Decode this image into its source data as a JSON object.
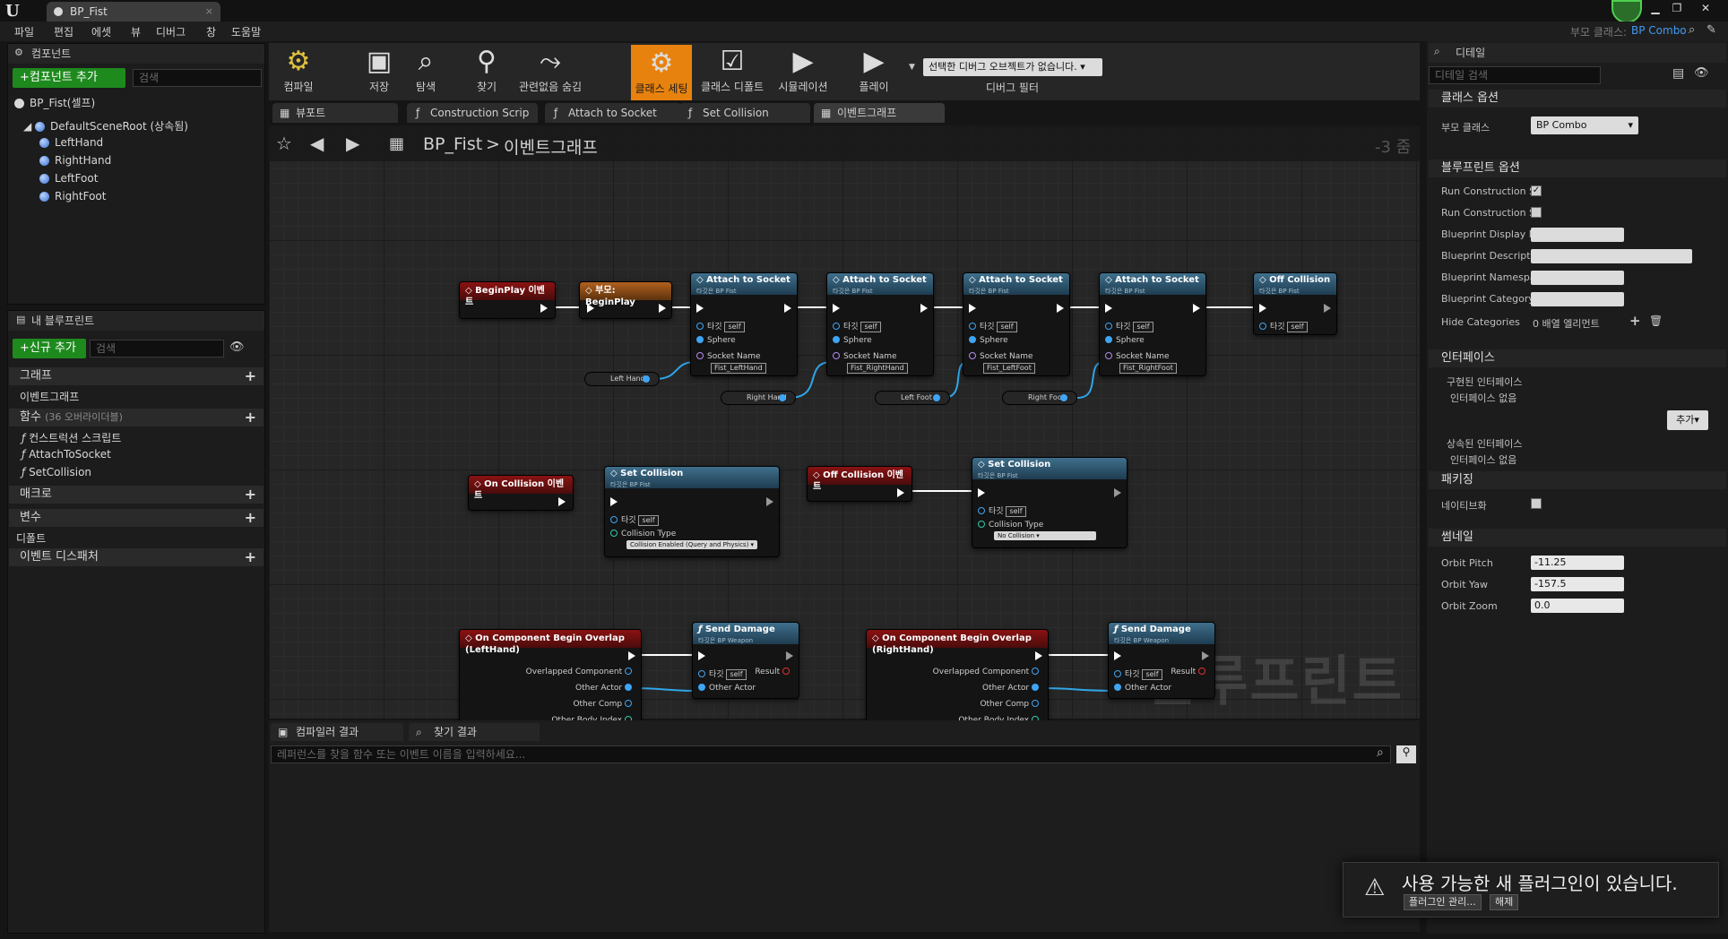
{
  "window": {
    "tab_title": "BP_Fist",
    "tab_close": "×"
  },
  "menu": [
    "파일",
    "편집",
    "에셋",
    "뷰",
    "디버그",
    "창",
    "도움말"
  ],
  "header_right": {
    "parent_class_label": "부모 클래스:",
    "parent_class_value": "BP Combo"
  },
  "components_panel": {
    "title": "컴포넌트",
    "add_button": "+컴포넌트 추가",
    "search_placeholder": "검색",
    "root_item": "BP_Fist(셀프)",
    "scene_root": "DefaultSceneRoot (상속됨)",
    "children": [
      "LeftHand",
      "RightHand",
      "LeftFoot",
      "RightFoot"
    ]
  },
  "my_blueprint": {
    "title": "내 블루프린트",
    "add_button": "+신규 추가",
    "search_placeholder": "검색",
    "sections": {
      "graphs": "그래프",
      "event_graph": "이벤트그래프",
      "functions": "함수",
      "functions_count": "(36 오버라이더블)",
      "function_items": [
        "컨스트럭션 스크립트",
        "AttachToSocket",
        "SetCollision"
      ],
      "macros": "매크로",
      "variables": "변수",
      "default": "디폴트",
      "dispatchers": "이벤트 디스패처"
    }
  },
  "toolbar": {
    "compile": "컴파일",
    "save": "저장",
    "browse": "탐색",
    "find": "찾기",
    "hide_unrelated": "관련없음 숨김",
    "class_settings": "클래스 세팅",
    "class_defaults": "클래스 디폴트",
    "simulation": "시뮬레이션",
    "play": "플레이",
    "debug_object": "선택한 디버그 오브젝트가 없습니다.",
    "debug_filter": "디버그 필터"
  },
  "graph_tabs": [
    "뷰포트",
    "Construction Scrip",
    "Attach to Socket",
    "Set Collision",
    "이벤트그래프"
  ],
  "graph": {
    "breadcrumb_root": "BP_Fist",
    "breadcrumb_sep": ">",
    "breadcrumb_current": "이벤트그래프",
    "zoom": "-3 줌",
    "watermark": "블루프린트"
  },
  "nodes": {
    "beginplay": "BeginPlay 이벤트",
    "parent_beginplay": "부모: BeginPlay",
    "attach_title": "Attach to Socket",
    "bp_fist_target": "타깃은 BP Fist",
    "target": "타깃",
    "self": "self",
    "sphere": "Sphere",
    "socket_name": "Socket Name",
    "sockets": [
      "Fist_LeftHand",
      "Fist_RightHand",
      "Fist_LeftFoot",
      "Fist_RightFoot"
    ],
    "off_collision": "Off Collision",
    "vars": [
      "Left Hand",
      "Right Hand",
      "Left Foot",
      "Right Foot"
    ],
    "on_collision_event": "On Collision 이벤트",
    "off_collision_event": "Off Collision 이벤트",
    "set_collision": "Set Collision",
    "collision_type": "Collision Type",
    "collision_enabled": "Collision Enabled (Query and Physics)",
    "no_collision": "No Collision",
    "overlap_left": "On Component Begin Overlap (LeftHand)",
    "overlap_right": "On Component Begin Overlap (RightHand)",
    "overlapped_component": "Overlapped Component",
    "other_actor": "Other Actor",
    "other_comp": "Other Comp",
    "other_body_index": "Other Body Index",
    "send_damage": "Send Damage",
    "bp_weapon_target": "타깃은 BP Weapon",
    "result": "Result"
  },
  "bottom_panel": {
    "tabs": [
      "컴파일러 결과",
      "찾기 결과"
    ],
    "search_placeholder": "레퍼런스를 찾을 함수 또는 이벤트 이름을 입력하세요..."
  },
  "details": {
    "title": "디테일",
    "search_placeholder": "디테일 검색",
    "class_options": "클래스 옵션",
    "parent_class": "부모 클래스",
    "parent_class_value": "BP Combo",
    "blueprint_options": "블루프린트 옵션",
    "rows": [
      "Run Construction S",
      "Run Construction S",
      "Blueprint Display N",
      "Blueprint Descripti",
      "Blueprint Namespa",
      "Blueprint Category",
      "Hide Categories"
    ],
    "hide_categories_value": "0 배열 엘리먼트",
    "interfaces": "인터페이스",
    "implemented": "구현된 인터페이스",
    "no_interface": "인터페이스 없음",
    "add_button": "추가",
    "inherited": "상속된 인터페이스",
    "no_interface2": "인터페이스 없음",
    "packaging": "패키징",
    "nativize": "네이티브화",
    "thumbnail": "썸네일",
    "orbit_pitch": "Orbit Pitch",
    "orbit_pitch_value": "-11.25",
    "orbit_yaw": "Orbit Yaw",
    "orbit_yaw_value": "-157.5",
    "orbit_zoom": "Orbit Zoom",
    "orbit_zoom_value": "0.0"
  },
  "toast": {
    "message": "사용 가능한 새 플러그인이 있습니다.",
    "manage": "플러그인 관리...",
    "dismiss": "해제"
  }
}
